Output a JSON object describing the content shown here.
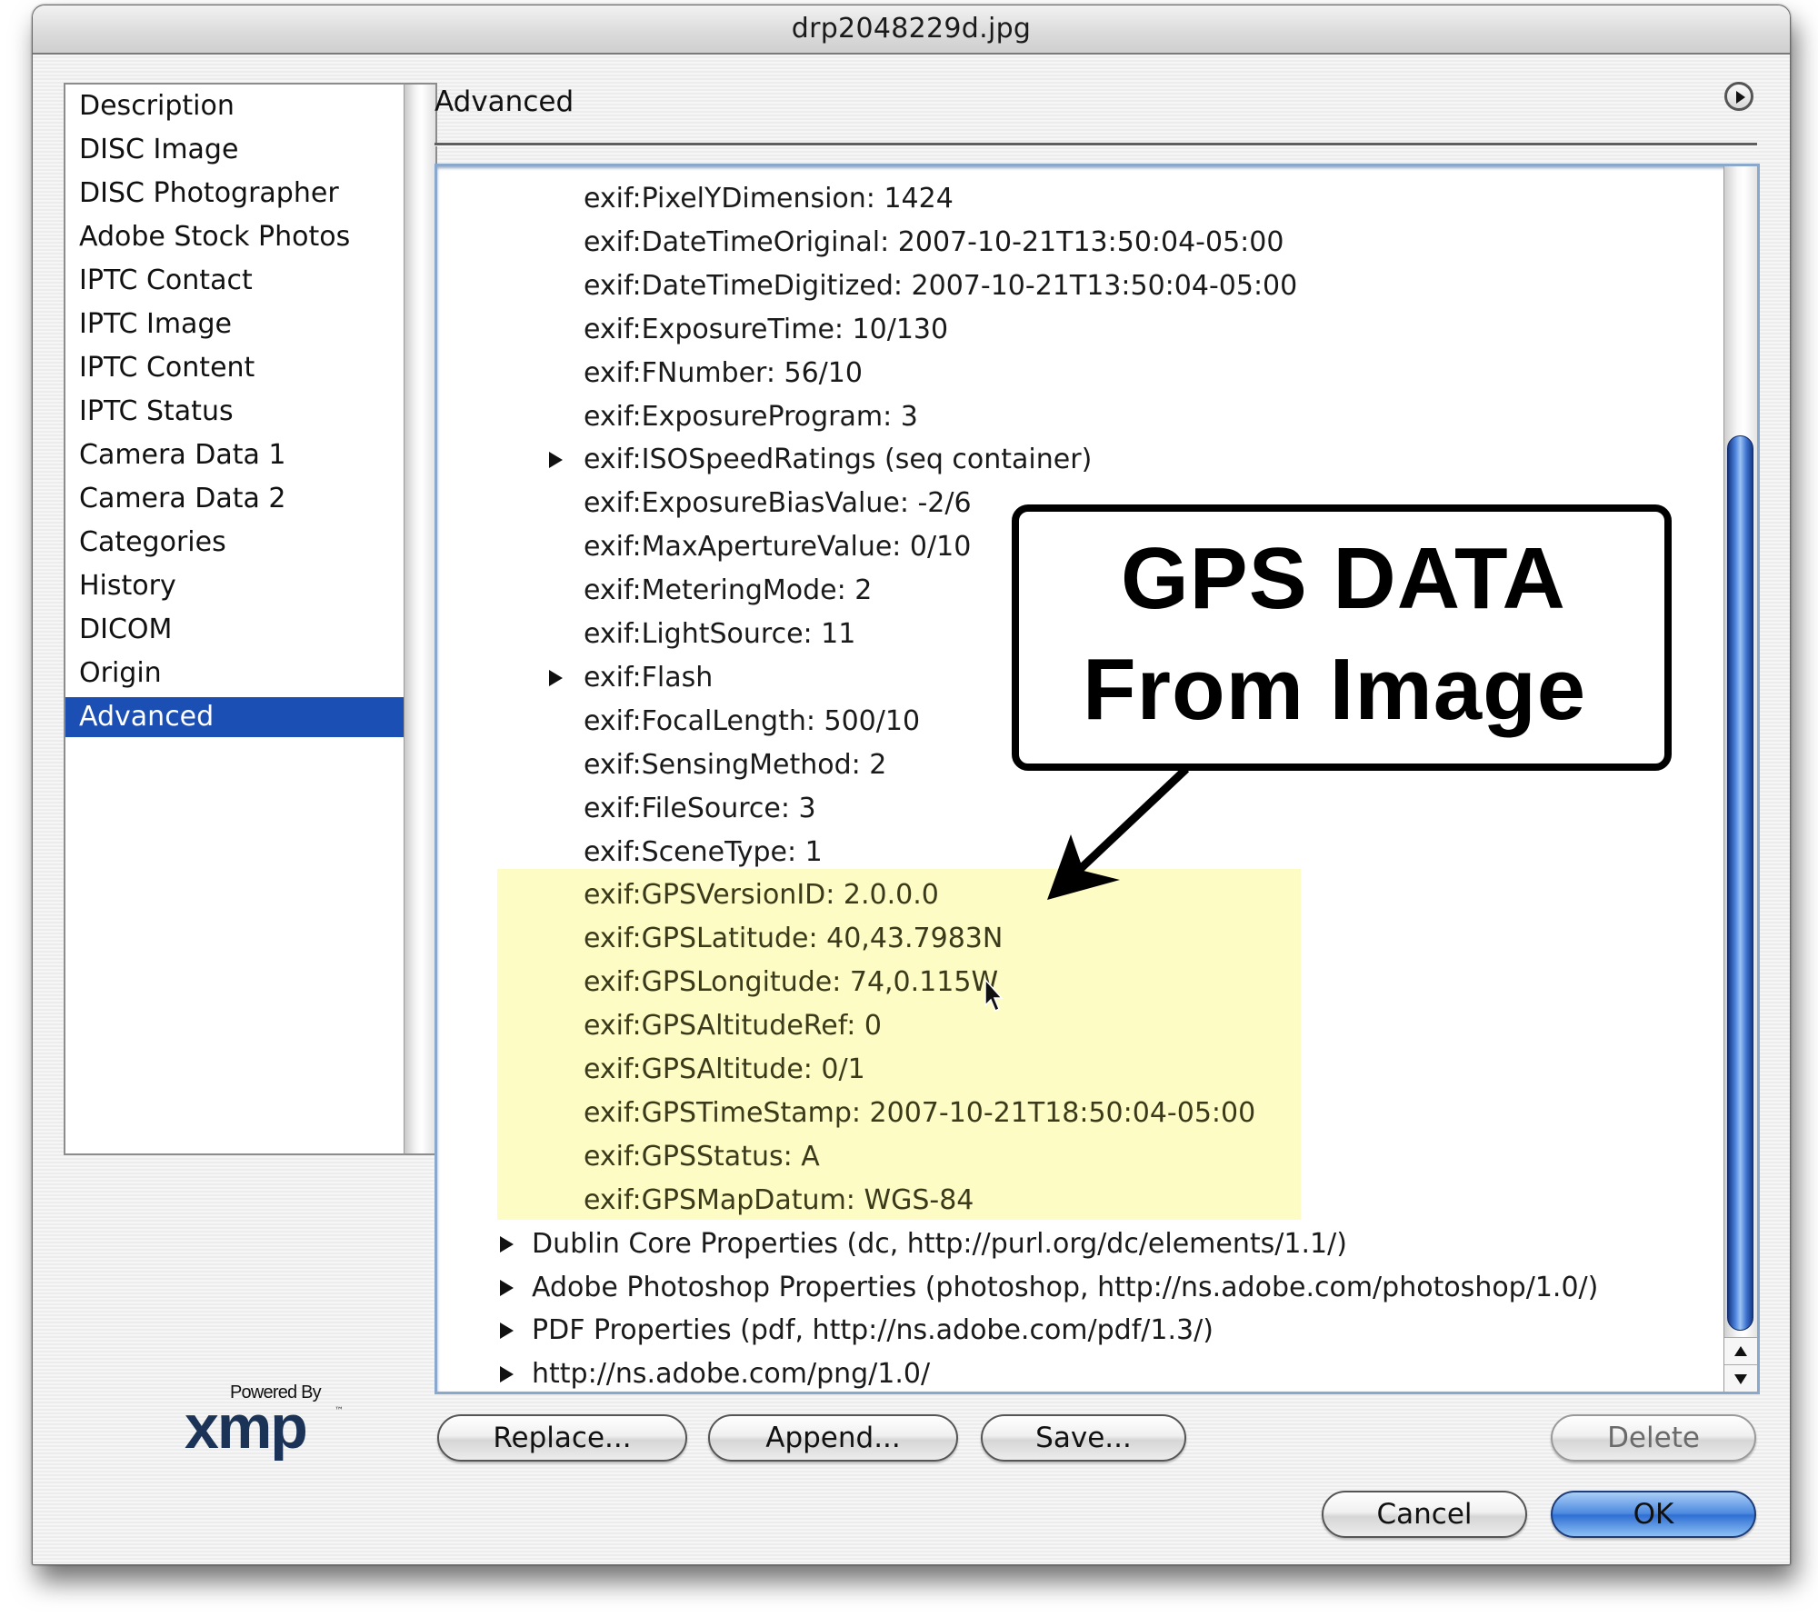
{
  "window": {
    "title": "drp2048229d.jpg"
  },
  "sidebar": {
    "items": [
      {
        "label": "Description",
        "selected": false
      },
      {
        "label": "DISC Image",
        "selected": false
      },
      {
        "label": "DISC Photographer",
        "selected": false
      },
      {
        "label": "Adobe Stock Photos",
        "selected": false
      },
      {
        "label": "IPTC Contact",
        "selected": false
      },
      {
        "label": "IPTC Image",
        "selected": false
      },
      {
        "label": "IPTC Content",
        "selected": false
      },
      {
        "label": "IPTC Status",
        "selected": false
      },
      {
        "label": "Camera Data 1",
        "selected": false
      },
      {
        "label": "Camera Data 2",
        "selected": false
      },
      {
        "label": "Categories",
        "selected": false
      },
      {
        "label": "History",
        "selected": false
      },
      {
        "label": "DICOM",
        "selected": false
      },
      {
        "label": "Origin",
        "selected": false
      },
      {
        "label": "Advanced",
        "selected": true
      }
    ],
    "selected_color": "#1c4fb3"
  },
  "main": {
    "section_title": "Advanced",
    "tree_rows": [
      {
        "text": "exif:PixelYDimension: 1424",
        "level": "child",
        "expandable": false,
        "gps": false
      },
      {
        "text": "exif:DateTimeOriginal: 2007-10-21T13:50:04-05:00",
        "level": "child",
        "expandable": false,
        "gps": false
      },
      {
        "text": "exif:DateTimeDigitized: 2007-10-21T13:50:04-05:00",
        "level": "child",
        "expandable": false,
        "gps": false
      },
      {
        "text": "exif:ExposureTime: 10/130",
        "level": "child",
        "expandable": false,
        "gps": false
      },
      {
        "text": "exif:FNumber: 56/10",
        "level": "child",
        "expandable": false,
        "gps": false
      },
      {
        "text": "exif:ExposureProgram: 3",
        "level": "child",
        "expandable": false,
        "gps": false
      },
      {
        "text": "exif:ISOSpeedRatings (seq container)",
        "level": "child",
        "expandable": true,
        "gps": false
      },
      {
        "text": "exif:ExposureBiasValue: -2/6",
        "level": "child",
        "expandable": false,
        "gps": false
      },
      {
        "text": "exif:MaxApertureValue: 0/10",
        "level": "child",
        "expandable": false,
        "gps": false
      },
      {
        "text": "exif:MeteringMode: 2",
        "level": "child",
        "expandable": false,
        "gps": false
      },
      {
        "text": "exif:LightSource: 11",
        "level": "child",
        "expandable": false,
        "gps": false
      },
      {
        "text": "exif:Flash",
        "level": "child",
        "expandable": true,
        "gps": false
      },
      {
        "text": "exif:FocalLength: 500/10",
        "level": "child",
        "expandable": false,
        "gps": false
      },
      {
        "text": "exif:SensingMethod: 2",
        "level": "child",
        "expandable": false,
        "gps": false
      },
      {
        "text": "exif:FileSource: 3",
        "level": "child",
        "expandable": false,
        "gps": false
      },
      {
        "text": "exif:SceneType: 1",
        "level": "child",
        "expandable": false,
        "gps": false
      },
      {
        "text": "exif:GPSVersionID: 2.0.0.0",
        "level": "child",
        "expandable": false,
        "gps": true
      },
      {
        "text": "exif:GPSLatitude: 40,43.7983N",
        "level": "child",
        "expandable": false,
        "gps": true
      },
      {
        "text": "exif:GPSLongitude: 74,0.115W",
        "level": "child",
        "expandable": false,
        "gps": true
      },
      {
        "text": "exif:GPSAltitudeRef: 0",
        "level": "child",
        "expandable": false,
        "gps": true
      },
      {
        "text": "exif:GPSAltitude: 0/1",
        "level": "child",
        "expandable": false,
        "gps": true
      },
      {
        "text": "exif:GPSTimeStamp: 2007-10-21T18:50:04-05:00",
        "level": "child",
        "expandable": false,
        "gps": true
      },
      {
        "text": "exif:GPSStatus: A",
        "level": "child",
        "expandable": false,
        "gps": true
      },
      {
        "text": "exif:GPSMapDatum: WGS-84",
        "level": "child",
        "expandable": false,
        "gps": true
      },
      {
        "text": "Dublin Core Properties (dc, http://purl.org/dc/elements/1.1/)",
        "level": "top",
        "expandable": true,
        "gps": false
      },
      {
        "text": "Adobe Photoshop Properties (photoshop, http://ns.adobe.com/photoshop/1.0/)",
        "level": "top",
        "expandable": true,
        "gps": false
      },
      {
        "text": "PDF Properties (pdf, http://ns.adobe.com/pdf/1.3/)",
        "level": "top",
        "expandable": true,
        "gps": false
      },
      {
        "text": "http://ns.adobe.com/png/1.0/",
        "level": "top",
        "expandable": true,
        "gps": false
      }
    ],
    "highlight_color": "#fdfcc4"
  },
  "callout": {
    "line1": "GPS DATA",
    "line2": "From Image"
  },
  "buttons": {
    "replace": "Replace...",
    "append": "Append...",
    "save": "Save...",
    "delete": "Delete",
    "cancel": "Cancel",
    "ok": "OK"
  },
  "logo": {
    "powered_by": "Powered By",
    "mark": "xmp",
    "tm": "™"
  },
  "icons": {
    "panel_menu": "circle-play-icon",
    "expand": "disclosure-triangle-icon",
    "scroll_up": "arrow-up-icon",
    "scroll_down": "arrow-down-icon",
    "pointer": "mouse-cursor-icon"
  }
}
